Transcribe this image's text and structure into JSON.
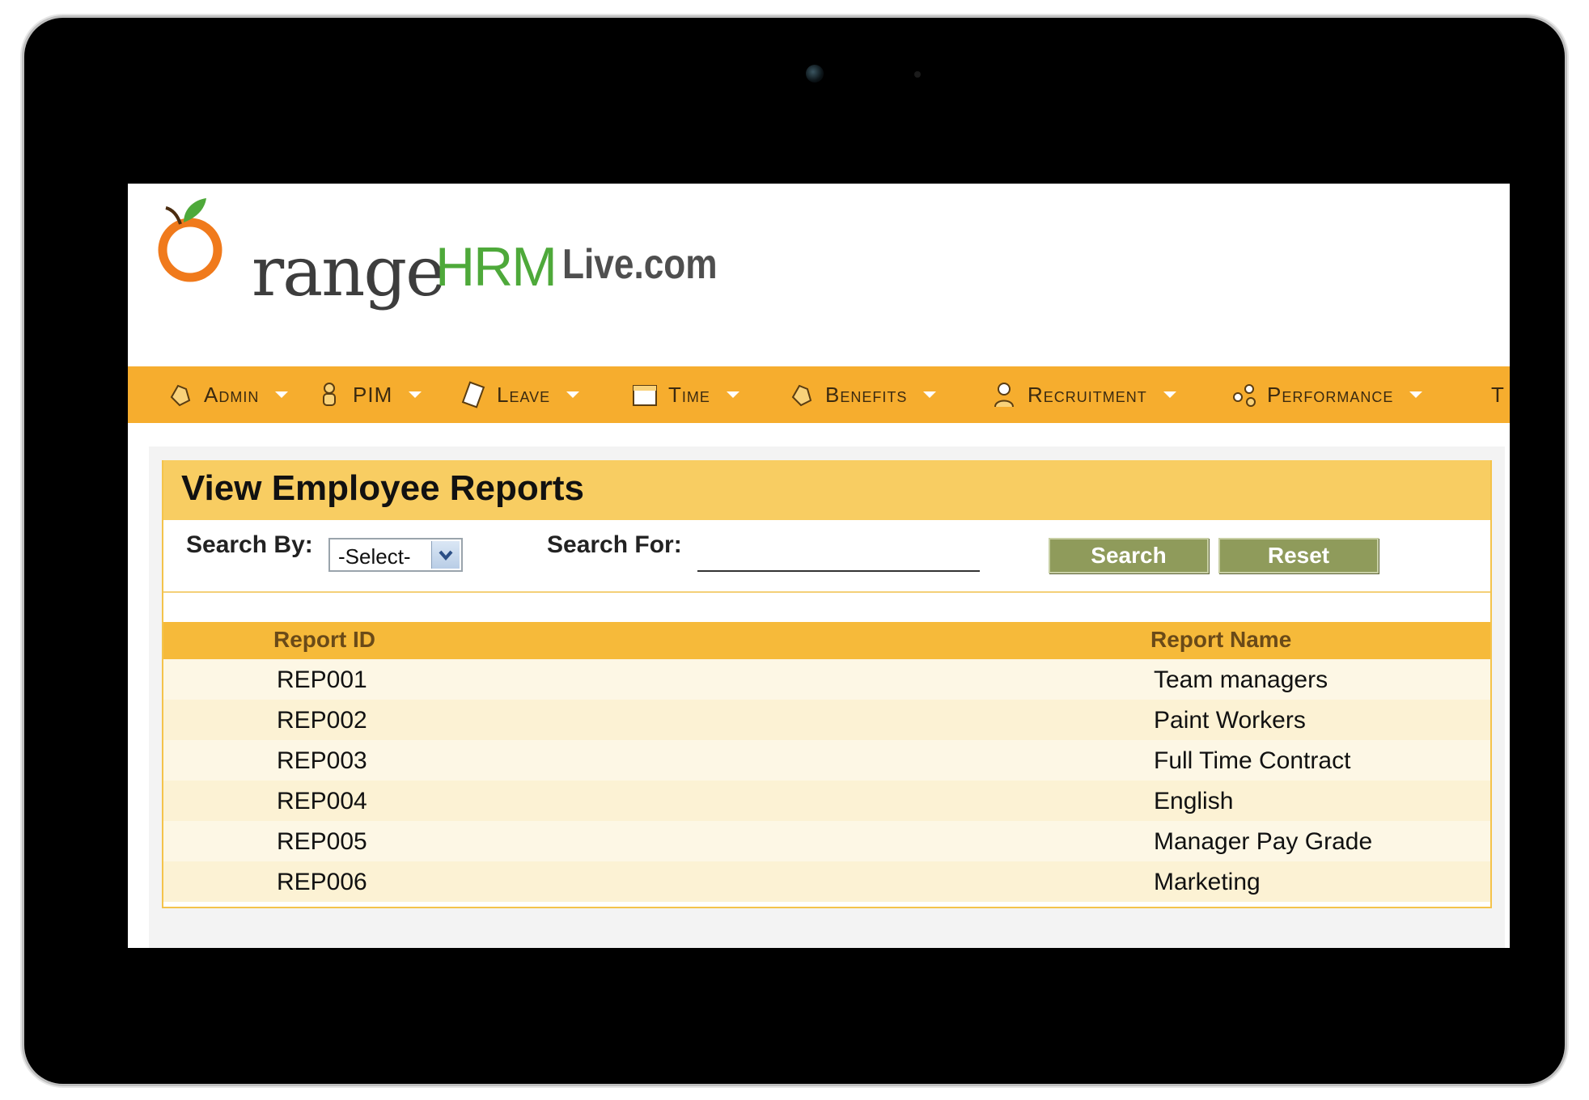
{
  "logo": {
    "main": "range",
    "hrm": "HRM",
    "suffix": "Live.com"
  },
  "nav": [
    {
      "label": "Admin",
      "icon": "admin-icon"
    },
    {
      "label": "PIM",
      "icon": "pim-icon"
    },
    {
      "label": "Leave",
      "icon": "leave-icon"
    },
    {
      "label": "Time",
      "icon": "time-icon"
    },
    {
      "label": "Benefits",
      "icon": "benefits-icon"
    },
    {
      "label": "Recruitment",
      "icon": "recruitment-icon"
    },
    {
      "label": "Performance",
      "icon": "performance-icon"
    },
    {
      "label": "T",
      "icon": ""
    }
  ],
  "page": {
    "title": "View Employee Reports"
  },
  "search": {
    "by_label": "Search By:",
    "by_value": "-Select-",
    "for_label": "Search For:",
    "search_button": "Search",
    "reset_button": "Reset"
  },
  "table": {
    "headers": [
      "Report ID",
      "Report Name"
    ],
    "rows": [
      [
        "REP001",
        "Team managers"
      ],
      [
        "REP002",
        "Paint Workers"
      ],
      [
        "REP003",
        "Full Time Contract"
      ],
      [
        "REP004",
        "English"
      ],
      [
        "REP005",
        "Manager Pay Grade"
      ],
      [
        "REP006",
        "Marketing"
      ]
    ]
  },
  "colors": {
    "nav_bg": "#f6ad2e",
    "header_bg": "#f8cd62",
    "button_bg": "#8f9b5b",
    "logo_orange": "#f07a1c",
    "logo_green": "#4ea93a"
  }
}
